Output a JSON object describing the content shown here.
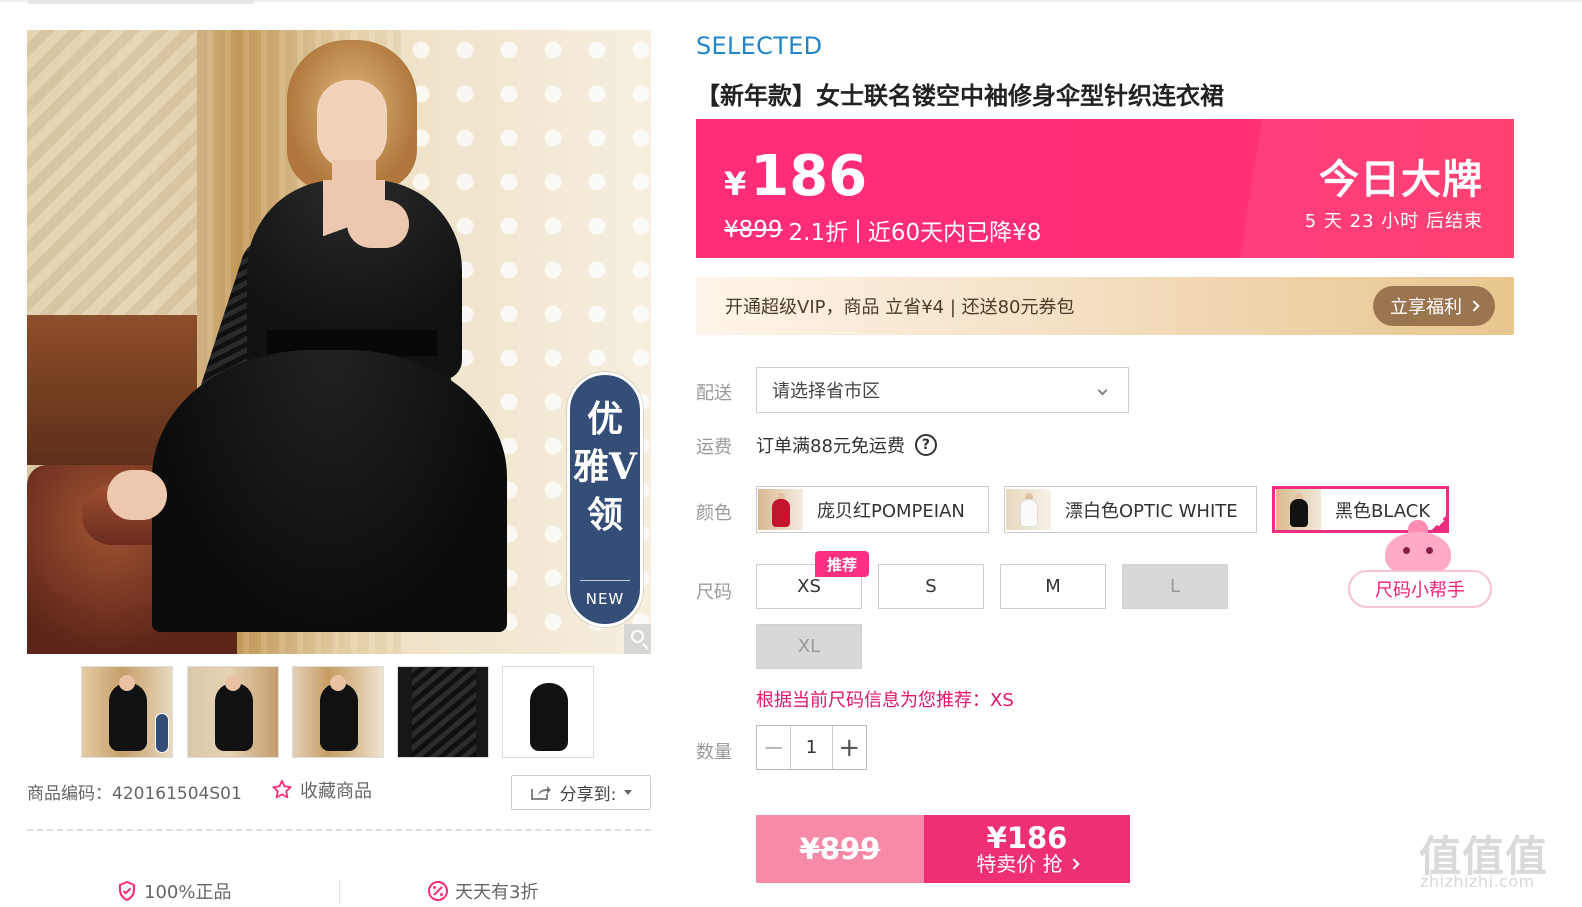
{
  "gallery": {
    "badge_title": "优雅V领",
    "badge_subtitle": "NEW",
    "thumbnail_count": 5
  },
  "product": {
    "brand": "SELECTED",
    "title": "【新年款】女士联名镂空中袖修身伞型针织连衣裙",
    "sku_label": "商品编码：",
    "sku_value": "420161504S01"
  },
  "actions": {
    "favorite_label": "收藏商品",
    "share_label": "分享到:"
  },
  "promises": [
    {
      "label": "100%正品"
    },
    {
      "label": "天天有3折"
    }
  ],
  "price_banner": {
    "currency": "¥",
    "price": "186",
    "original_price": "¥899",
    "discount": "2.1折",
    "separator": "|",
    "price_drop": "近60天内已降¥8",
    "campaign_name": "今日大牌",
    "countdown": "5 天 23 小时 后结束"
  },
  "vip": {
    "text": "开通超级VIP，商品 立省¥4 | 还送80元券包",
    "button": "立享福利"
  },
  "options": {
    "delivery_label": "配送",
    "delivery_value": "请选择省市区",
    "shipping_label": "运费",
    "shipping_value": "订单满88元免运费",
    "help_symbol": "?",
    "color_label": "颜色",
    "colors": [
      {
        "label": "庞贝红POMPEIAN"
      },
      {
        "label": "漂白色OPTIC WHITE"
      },
      {
        "label": "黑色BLACK"
      }
    ],
    "size_label": "尺码",
    "sizes": [
      {
        "label": "XS"
      },
      {
        "label": "S"
      },
      {
        "label": "M"
      },
      {
        "label": "L"
      },
      {
        "label": "XL"
      }
    ],
    "recommend_badge": "推荐",
    "size_helper": "尺码小帮手",
    "size_recommendation": "根据当前尺码信息为您推荐：XS",
    "quantity_label": "数量",
    "quantity_minus": "−",
    "quantity_value": "1",
    "quantity_plus": "+"
  },
  "purchase": {
    "original_price": "¥899",
    "special_price": "¥186",
    "special_label": "特卖价 抢"
  },
  "watermark": {
    "logo": "值值值",
    "domain": "zhizhizhi.com"
  },
  "colors": {
    "brand_blue": "#1f86c8",
    "primary_pink": "#ff2c7a",
    "selection_pink": "#ef2e82",
    "vip_brown": "#9b7450"
  }
}
